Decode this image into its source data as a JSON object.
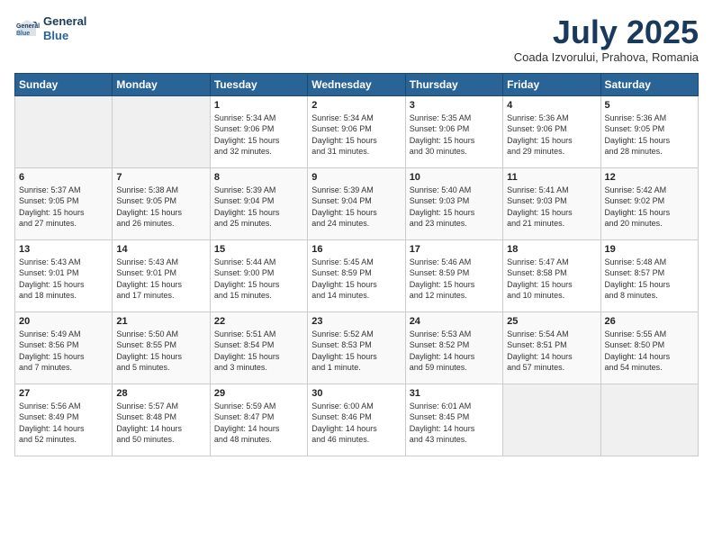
{
  "header": {
    "logo_line1": "General",
    "logo_line2": "Blue",
    "title": "July 2025",
    "subtitle": "Coada Izvorului, Prahova, Romania"
  },
  "weekdays": [
    "Sunday",
    "Monday",
    "Tuesday",
    "Wednesday",
    "Thursday",
    "Friday",
    "Saturday"
  ],
  "weeks": [
    [
      {
        "day": "",
        "info": ""
      },
      {
        "day": "",
        "info": ""
      },
      {
        "day": "1",
        "info": "Sunrise: 5:34 AM\nSunset: 9:06 PM\nDaylight: 15 hours\nand 32 minutes."
      },
      {
        "day": "2",
        "info": "Sunrise: 5:34 AM\nSunset: 9:06 PM\nDaylight: 15 hours\nand 31 minutes."
      },
      {
        "day": "3",
        "info": "Sunrise: 5:35 AM\nSunset: 9:06 PM\nDaylight: 15 hours\nand 30 minutes."
      },
      {
        "day": "4",
        "info": "Sunrise: 5:36 AM\nSunset: 9:06 PM\nDaylight: 15 hours\nand 29 minutes."
      },
      {
        "day": "5",
        "info": "Sunrise: 5:36 AM\nSunset: 9:05 PM\nDaylight: 15 hours\nand 28 minutes."
      }
    ],
    [
      {
        "day": "6",
        "info": "Sunrise: 5:37 AM\nSunset: 9:05 PM\nDaylight: 15 hours\nand 27 minutes."
      },
      {
        "day": "7",
        "info": "Sunrise: 5:38 AM\nSunset: 9:05 PM\nDaylight: 15 hours\nand 26 minutes."
      },
      {
        "day": "8",
        "info": "Sunrise: 5:39 AM\nSunset: 9:04 PM\nDaylight: 15 hours\nand 25 minutes."
      },
      {
        "day": "9",
        "info": "Sunrise: 5:39 AM\nSunset: 9:04 PM\nDaylight: 15 hours\nand 24 minutes."
      },
      {
        "day": "10",
        "info": "Sunrise: 5:40 AM\nSunset: 9:03 PM\nDaylight: 15 hours\nand 23 minutes."
      },
      {
        "day": "11",
        "info": "Sunrise: 5:41 AM\nSunset: 9:03 PM\nDaylight: 15 hours\nand 21 minutes."
      },
      {
        "day": "12",
        "info": "Sunrise: 5:42 AM\nSunset: 9:02 PM\nDaylight: 15 hours\nand 20 minutes."
      }
    ],
    [
      {
        "day": "13",
        "info": "Sunrise: 5:43 AM\nSunset: 9:01 PM\nDaylight: 15 hours\nand 18 minutes."
      },
      {
        "day": "14",
        "info": "Sunrise: 5:43 AM\nSunset: 9:01 PM\nDaylight: 15 hours\nand 17 minutes."
      },
      {
        "day": "15",
        "info": "Sunrise: 5:44 AM\nSunset: 9:00 PM\nDaylight: 15 hours\nand 15 minutes."
      },
      {
        "day": "16",
        "info": "Sunrise: 5:45 AM\nSunset: 8:59 PM\nDaylight: 15 hours\nand 14 minutes."
      },
      {
        "day": "17",
        "info": "Sunrise: 5:46 AM\nSunset: 8:59 PM\nDaylight: 15 hours\nand 12 minutes."
      },
      {
        "day": "18",
        "info": "Sunrise: 5:47 AM\nSunset: 8:58 PM\nDaylight: 15 hours\nand 10 minutes."
      },
      {
        "day": "19",
        "info": "Sunrise: 5:48 AM\nSunset: 8:57 PM\nDaylight: 15 hours\nand 8 minutes."
      }
    ],
    [
      {
        "day": "20",
        "info": "Sunrise: 5:49 AM\nSunset: 8:56 PM\nDaylight: 15 hours\nand 7 minutes."
      },
      {
        "day": "21",
        "info": "Sunrise: 5:50 AM\nSunset: 8:55 PM\nDaylight: 15 hours\nand 5 minutes."
      },
      {
        "day": "22",
        "info": "Sunrise: 5:51 AM\nSunset: 8:54 PM\nDaylight: 15 hours\nand 3 minutes."
      },
      {
        "day": "23",
        "info": "Sunrise: 5:52 AM\nSunset: 8:53 PM\nDaylight: 15 hours\nand 1 minute."
      },
      {
        "day": "24",
        "info": "Sunrise: 5:53 AM\nSunset: 8:52 PM\nDaylight: 14 hours\nand 59 minutes."
      },
      {
        "day": "25",
        "info": "Sunrise: 5:54 AM\nSunset: 8:51 PM\nDaylight: 14 hours\nand 57 minutes."
      },
      {
        "day": "26",
        "info": "Sunrise: 5:55 AM\nSunset: 8:50 PM\nDaylight: 14 hours\nand 54 minutes."
      }
    ],
    [
      {
        "day": "27",
        "info": "Sunrise: 5:56 AM\nSunset: 8:49 PM\nDaylight: 14 hours\nand 52 minutes."
      },
      {
        "day": "28",
        "info": "Sunrise: 5:57 AM\nSunset: 8:48 PM\nDaylight: 14 hours\nand 50 minutes."
      },
      {
        "day": "29",
        "info": "Sunrise: 5:59 AM\nSunset: 8:47 PM\nDaylight: 14 hours\nand 48 minutes."
      },
      {
        "day": "30",
        "info": "Sunrise: 6:00 AM\nSunset: 8:46 PM\nDaylight: 14 hours\nand 46 minutes."
      },
      {
        "day": "31",
        "info": "Sunrise: 6:01 AM\nSunset: 8:45 PM\nDaylight: 14 hours\nand 43 minutes."
      },
      {
        "day": "",
        "info": ""
      },
      {
        "day": "",
        "info": ""
      }
    ]
  ]
}
